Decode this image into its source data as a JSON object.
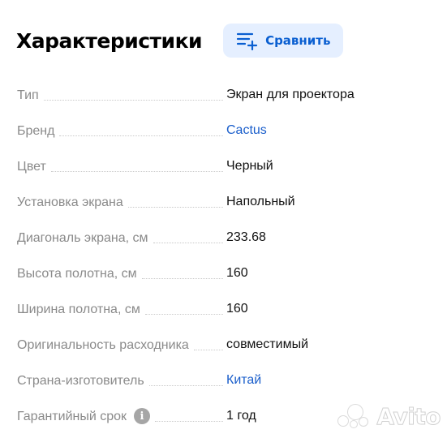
{
  "header": {
    "title": "Характеристики",
    "compare_button_label": "Сравнить"
  },
  "specs": [
    {
      "label": "Тип",
      "value": "Экран для проектора",
      "link": false
    },
    {
      "label": "Бренд",
      "value": "Cactus",
      "link": true
    },
    {
      "label": "Цвет",
      "value": "Черный",
      "link": false
    },
    {
      "label": "Установка экрана",
      "value": "Напольный",
      "link": false
    },
    {
      "label": "Диагональ экрана, см",
      "value": "233.68",
      "link": false
    },
    {
      "label": "Высота полотна, см",
      "value": "160",
      "link": false
    },
    {
      "label": "Ширина полотна, см",
      "value": "160",
      "link": false
    },
    {
      "label": "Оригинальность расходника",
      "value": "совместимый",
      "link": false
    },
    {
      "label": "Страна-изготовитель",
      "value": "Китай",
      "link": true
    },
    {
      "label": "Гарантийный срок",
      "value": "1 год",
      "link": false,
      "info_icon": "info-icon"
    }
  ],
  "watermark": {
    "text": "Avito"
  },
  "colors": {
    "accent": "#0a5fd1",
    "link": "#1a5ecb",
    "button_bg": "#e5efff",
    "label_gray": "#8a8a8a",
    "info_icon_bg": "#a6a6a6"
  },
  "icons": {
    "compare": "list-plus-icon",
    "info": "info-icon"
  }
}
